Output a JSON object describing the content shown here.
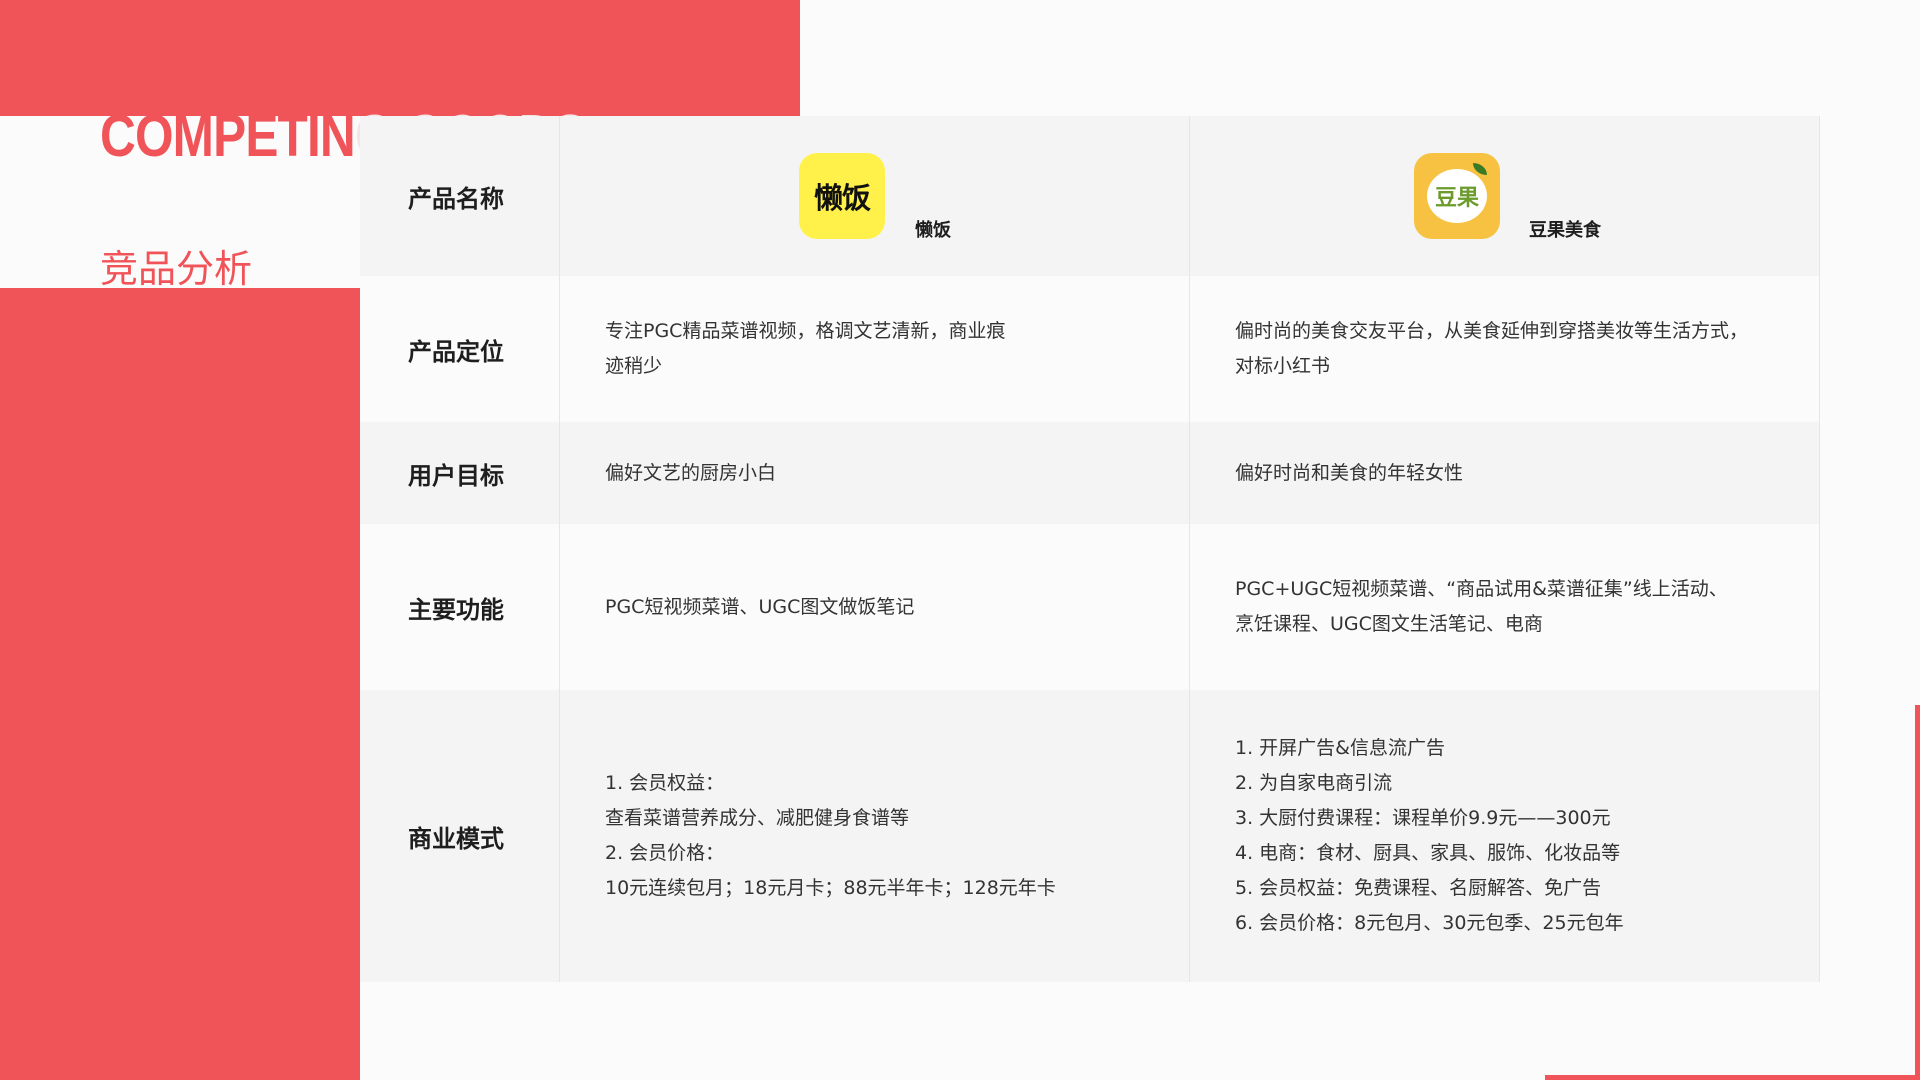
{
  "header": {
    "title_en_main": "COMPETIN",
    "title_en_fade": "G GOODS",
    "title_cn": "竞品分析"
  },
  "colors": {
    "accent": "#f05458",
    "logo_lanfan": "#fff14a",
    "logo_douguo": "#f7c141"
  },
  "table": {
    "row_labels": [
      "产品名称",
      "产品定位",
      "用户目标",
      "主要功能",
      "商业模式"
    ],
    "products": [
      {
        "name": "懒饭",
        "logo_text": "懒饭",
        "icon": "lanfan-logo-icon"
      },
      {
        "name": "豆果美食",
        "logo_text": "豆果",
        "icon": "douguo-logo-icon"
      }
    ],
    "positioning": [
      [
        "专注PGC精品菜谱视频，格调文艺清新，商业痕",
        "迹稍少"
      ],
      [
        "偏时尚的美食交友平台，从美食延伸到穿搭美妆等生活方式，",
        "对标小红书"
      ]
    ],
    "user_target": [
      "偏好文艺的厨房小白",
      "偏好时尚和美食的年轻女性"
    ],
    "features": [
      [
        "PGC短视频菜谱、UGC图文做饭笔记"
      ],
      [
        "PGC+UGC短视频菜谱、“商品试用&菜谱征集”线上活动、",
        "烹饪课程、UGC图文生活笔记、电商"
      ]
    ],
    "business_model": [
      [
        "1.  会员权益：",
        "查看菜谱营养成分、减肥健身食谱等",
        "2. 会员价格：",
        "10元连续包月；18元月卡；88元半年卡；128元年卡"
      ],
      [
        "1. 开屏广告&信息流广告",
        "2. 为自家电商引流",
        "3. 大厨付费课程：课程单价9.9元——300元",
        "4. 电商：食材、厨具、家具、服饰、化妆品等",
        "5. 会员权益：免费课程、名厨解答、免广告",
        "6. 会员价格：8元包月、30元包季、25元包年"
      ]
    ]
  }
}
